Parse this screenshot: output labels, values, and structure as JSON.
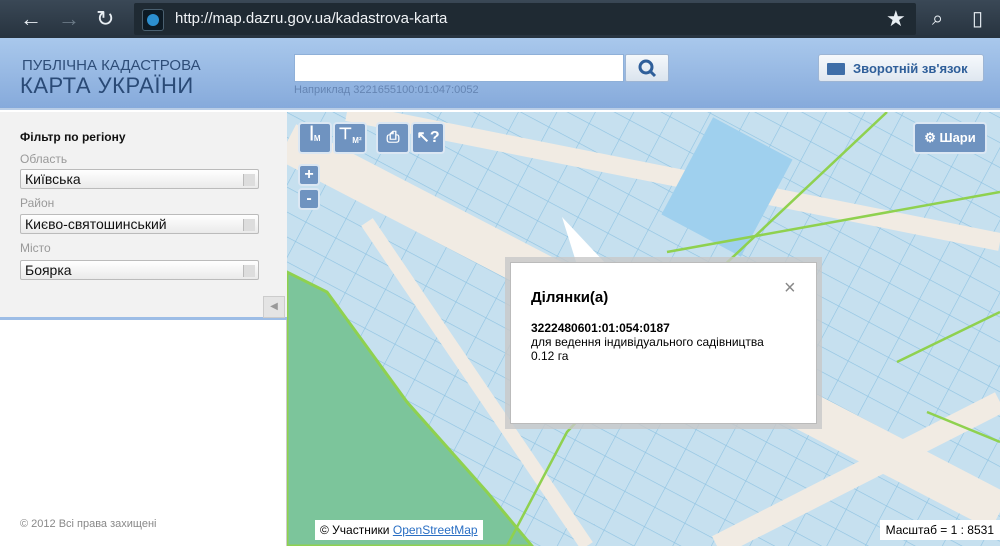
{
  "browser": {
    "url": "http://map.dazru.gov.ua/kadastrova-karta"
  },
  "header": {
    "logo_line1": "ПУБЛІЧНА КАДАСТРОВА",
    "logo_line2": "КАРТА УКРАЇНИ",
    "search_value": "",
    "search_hint": "Наприклад 3221655100:01:047:0052",
    "feedback_label": "Зворотній зв'язок"
  },
  "filter": {
    "title": "Фільтр по регіону",
    "oblast_label": "Область",
    "oblast_value": "Київська",
    "raion_label": "Район",
    "raion_value": "Києво-святошинський",
    "misto_label": "Місто",
    "misto_value": "Боярка",
    "copyright": "© 2012 Всі права захищені"
  },
  "map": {
    "tool_length_sub": "М",
    "tool_area_sub": "М²",
    "zoom_in": "+",
    "zoom_out": "-",
    "layers_label": "Шари",
    "attribution_prefix": "© Участники",
    "attribution_link": "OpenStreetMap",
    "scale": "Масштаб = 1 : 8531"
  },
  "popup": {
    "title": "Ділянки(а)",
    "cadastral_number": "3222480601:01:054:0187",
    "purpose": "для ведення індивідуального садівництва",
    "area": "0.12 га",
    "close": "×"
  },
  "colors": {
    "parcel": "#c6e0ef",
    "road": "#f1ebe3",
    "forest": "#7cc59b",
    "boundary": "#8fd14f",
    "panel_accent": "#6f93c0"
  }
}
